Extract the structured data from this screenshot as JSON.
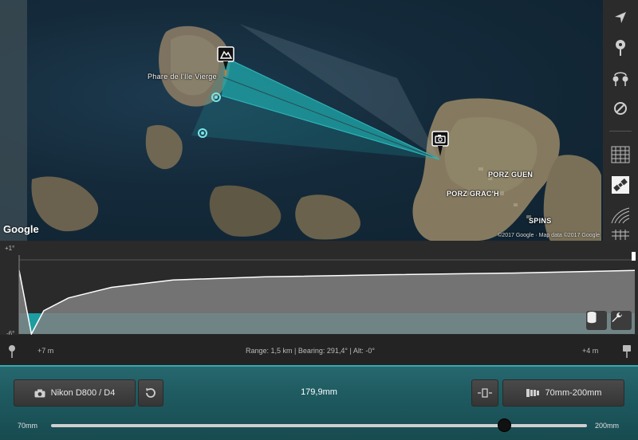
{
  "map": {
    "place_label": "Phare de l'Ile Vierge",
    "town_labels": [
      "PORZ GUEN",
      "PORZ GRAC'H",
      "SPINS"
    ],
    "logo": "Google",
    "copyright": "©2017 Google · Map data ©2017 Google",
    "colors": {
      "sea": "#142a3a",
      "land": "#7a6e55",
      "cone": "#1fa6a8"
    }
  },
  "toolbar": {
    "items": [
      {
        "icon": "navigation-arrow-icon"
      },
      {
        "icon": "pin-icon"
      },
      {
        "icon": "double-pin-icon"
      },
      {
        "icon": "no-entry-icon"
      },
      {
        "icon": "terrain-grid-icon"
      },
      {
        "icon": "satellite-icon"
      },
      {
        "icon": "contour-icon"
      },
      {
        "icon": "grid-icon"
      }
    ]
  },
  "profile": {
    "y_max_label": "+1°",
    "y_min_label": "-6°",
    "curve_x": [
      0,
      0.02,
      0.04,
      0.08,
      0.15,
      0.25,
      0.4,
      0.6,
      0.8,
      1.0
    ],
    "curve_y_deg": [
      0.0,
      -6.0,
      -3.8,
      -2.6,
      -1.6,
      -0.9,
      -0.6,
      -0.4,
      -0.25,
      0.0
    ],
    "colors": {
      "fill": "#808080",
      "band": "#1d9da0",
      "line": "#ffffff"
    }
  },
  "info": {
    "left_elev": "+7 m",
    "right_elev": "+4 m",
    "summary": "Range: 1,5 km | Bearing: 291,4° | Alt: -0°"
  },
  "controls": {
    "camera_label": "Nikon D800 / D4",
    "focal_length": "179,9mm",
    "lens_label": "70mm-200mm",
    "slider_min_label": "70mm",
    "slider_max_label": "200mm",
    "slider_fraction": 0.845
  }
}
